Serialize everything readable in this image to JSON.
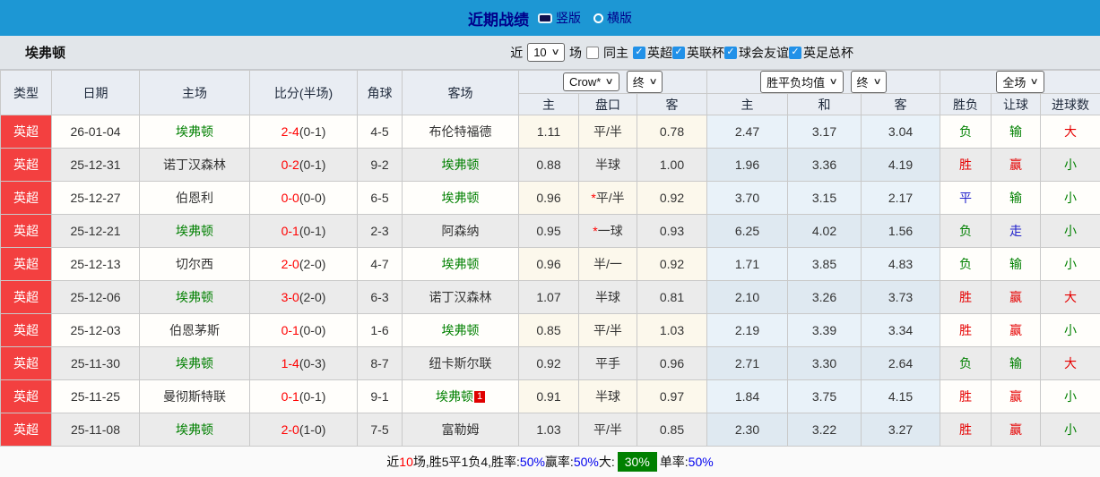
{
  "title_bar": {
    "title": "近期战绩",
    "radio_vertical": "竖版",
    "radio_horizontal": "横版"
  },
  "filter": {
    "team": "埃弗顿",
    "near_label": "近",
    "matches_value": "10",
    "matches_label": "场",
    "same_home_label": "同主",
    "competitions": [
      "英超",
      "英联杯",
      "球会友谊",
      "英足总杯"
    ]
  },
  "icons": {
    "chevron_down": "∨",
    "checkmark": "✓"
  },
  "table": {
    "group_headers": {
      "odds_company": "Crow*",
      "odds_final": "终",
      "avg_name": "胜平负均值",
      "avg_final": "终",
      "period": "全场"
    },
    "columns": [
      "类型",
      "日期",
      "主场",
      "比分(半场)",
      "角球",
      "客场",
      "主",
      "盘口",
      "客",
      "主",
      "和",
      "客",
      "胜负",
      "让球",
      "进球数"
    ]
  },
  "rows": [
    {
      "league": "英超",
      "date": "26-01-04",
      "home": "埃弗顿",
      "home_focus": true,
      "ft": "2-4",
      "ht": "(0-1)",
      "corner": "4-5",
      "away": "布伦特福德",
      "away_focus": false,
      "away_badge": "",
      "odds_home": "1.11",
      "handicap_star": false,
      "handicap": "平/半",
      "odds_away": "0.78",
      "avg_home": "2.47",
      "avg_draw": "3.17",
      "avg_away": "3.04",
      "wdl": "负",
      "handicap_result": "输",
      "goals_result": "大"
    },
    {
      "league": "英超",
      "date": "25-12-31",
      "home": "诺丁汉森林",
      "home_focus": false,
      "ft": "0-2",
      "ht": "(0-1)",
      "corner": "9-2",
      "away": "埃弗顿",
      "away_focus": true,
      "away_badge": "",
      "odds_home": "0.88",
      "handicap_star": false,
      "handicap": "半球",
      "odds_away": "1.00",
      "avg_home": "1.96",
      "avg_draw": "3.36",
      "avg_away": "4.19",
      "wdl": "胜",
      "handicap_result": "赢",
      "goals_result": "小"
    },
    {
      "league": "英超",
      "date": "25-12-27",
      "home": "伯恩利",
      "home_focus": false,
      "ft": "0-0",
      "ht": "(0-0)",
      "corner": "6-5",
      "away": "埃弗顿",
      "away_focus": true,
      "away_badge": "",
      "odds_home": "0.96",
      "handicap_star": true,
      "handicap": "平/半",
      "odds_away": "0.92",
      "avg_home": "3.70",
      "avg_draw": "3.15",
      "avg_away": "2.17",
      "wdl": "平",
      "handicap_result": "输",
      "goals_result": "小"
    },
    {
      "league": "英超",
      "date": "25-12-21",
      "home": "埃弗顿",
      "home_focus": true,
      "ft": "0-1",
      "ht": "(0-1)",
      "corner": "2-3",
      "away": "阿森纳",
      "away_focus": false,
      "away_badge": "",
      "odds_home": "0.95",
      "handicap_star": true,
      "handicap": "一球",
      "odds_away": "0.93",
      "avg_home": "6.25",
      "avg_draw": "4.02",
      "avg_away": "1.56",
      "wdl": "负",
      "handicap_result": "走",
      "goals_result": "小"
    },
    {
      "league": "英超",
      "date": "25-12-13",
      "home": "切尔西",
      "home_focus": false,
      "ft": "2-0",
      "ht": "(2-0)",
      "corner": "4-7",
      "away": "埃弗顿",
      "away_focus": true,
      "away_badge": "",
      "odds_home": "0.96",
      "handicap_star": false,
      "handicap": "半/一",
      "odds_away": "0.92",
      "avg_home": "1.71",
      "avg_draw": "3.85",
      "avg_away": "4.83",
      "wdl": "负",
      "handicap_result": "输",
      "goals_result": "小"
    },
    {
      "league": "英超",
      "date": "25-12-06",
      "home": "埃弗顿",
      "home_focus": true,
      "ft": "3-0",
      "ht": "(2-0)",
      "corner": "6-3",
      "away": "诺丁汉森林",
      "away_focus": false,
      "away_badge": "",
      "odds_home": "1.07",
      "handicap_star": false,
      "handicap": "半球",
      "odds_away": "0.81",
      "avg_home": "2.10",
      "avg_draw": "3.26",
      "avg_away": "3.73",
      "wdl": "胜",
      "handicap_result": "赢",
      "goals_result": "大"
    },
    {
      "league": "英超",
      "date": "25-12-03",
      "home": "伯恩茅斯",
      "home_focus": false,
      "ft": "0-1",
      "ht": "(0-0)",
      "corner": "1-6",
      "away": "埃弗顿",
      "away_focus": true,
      "away_badge": "",
      "odds_home": "0.85",
      "handicap_star": false,
      "handicap": "平/半",
      "odds_away": "1.03",
      "avg_home": "2.19",
      "avg_draw": "3.39",
      "avg_away": "3.34",
      "wdl": "胜",
      "handicap_result": "赢",
      "goals_result": "小"
    },
    {
      "league": "英超",
      "date": "25-11-30",
      "home": "埃弗顿",
      "home_focus": true,
      "ft": "1-4",
      "ht": "(0-3)",
      "corner": "8-7",
      "away": "纽卡斯尔联",
      "away_focus": false,
      "away_badge": "",
      "odds_home": "0.92",
      "handicap_star": false,
      "handicap": "平手",
      "odds_away": "0.96",
      "avg_home": "2.71",
      "avg_draw": "3.30",
      "avg_away": "2.64",
      "wdl": "负",
      "handicap_result": "输",
      "goals_result": "大"
    },
    {
      "league": "英超",
      "date": "25-11-25",
      "home": "曼彻斯特联",
      "home_focus": false,
      "ft": "0-1",
      "ht": "(0-1)",
      "corner": "9-1",
      "away": "埃弗顿",
      "away_focus": true,
      "away_badge": "1",
      "odds_home": "0.91",
      "handicap_star": false,
      "handicap": "半球",
      "odds_away": "0.97",
      "avg_home": "1.84",
      "avg_draw": "3.75",
      "avg_away": "4.15",
      "wdl": "胜",
      "handicap_result": "赢",
      "goals_result": "小"
    },
    {
      "league": "英超",
      "date": "25-11-08",
      "home": "埃弗顿",
      "home_focus": true,
      "ft": "2-0",
      "ht": "(1-0)",
      "corner": "7-5",
      "away": "富勒姆",
      "away_focus": false,
      "away_badge": "",
      "odds_home": "1.03",
      "handicap_star": false,
      "handicap": "平/半",
      "odds_away": "0.85",
      "avg_home": "2.30",
      "avg_draw": "3.22",
      "avg_away": "3.27",
      "wdl": "胜",
      "handicap_result": "赢",
      "goals_result": "小"
    }
  ],
  "summary": {
    "segments": [
      {
        "text": "近",
        "type": "plain"
      },
      {
        "text": "10",
        "type": "red"
      },
      {
        "text": "场,胜5平1负4, ",
        "type": "plain"
      },
      {
        "text": "胜率:",
        "type": "plain"
      },
      {
        "text": "50%",
        "type": "blue"
      },
      {
        "text": " 赢率:",
        "type": "plain"
      },
      {
        "text": "50%",
        "type": "blue"
      },
      {
        "text": " 大:",
        "type": "plain"
      },
      {
        "text": "30%",
        "type": "greenbox"
      },
      {
        "text": " 单率:",
        "type": "plain"
      },
      {
        "text": "50%",
        "type": "blue"
      }
    ]
  },
  "colors": {
    "bar_blue": "#1d97d4",
    "title_navy": "#00008b",
    "league_badge": "#f34040",
    "score_red": "#ff0000",
    "focus_team_green": "#008000",
    "win_red": "#e60000",
    "draw_blue": "#2222cc",
    "lose_green": "#008000",
    "percent_blue": "#0000ee",
    "checkbox_blue": "#2191e8"
  }
}
